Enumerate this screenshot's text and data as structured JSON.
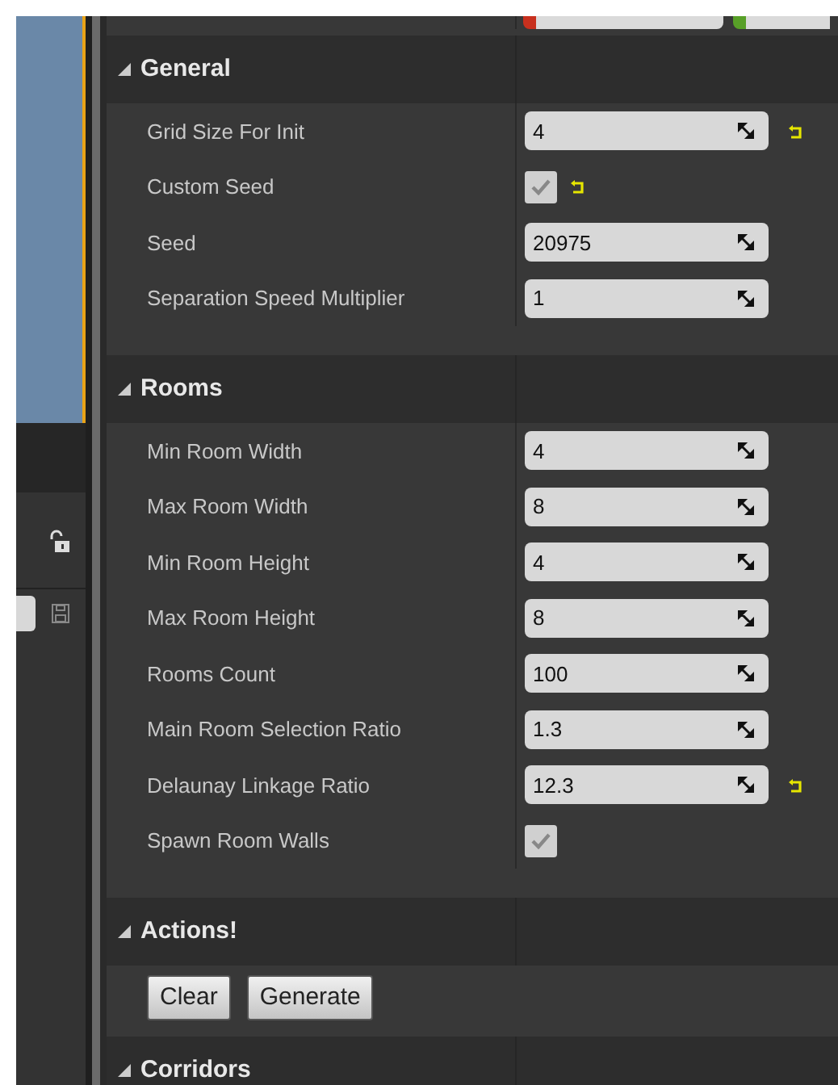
{
  "sections": [
    {
      "title": "General",
      "expanded": true,
      "rows": [
        {
          "kind": "number",
          "label": "Grid Size For Init",
          "value": "4",
          "reset": true
        },
        {
          "kind": "checkbox",
          "label": "Custom Seed",
          "checked": true,
          "reset": true
        },
        {
          "kind": "number",
          "label": "Seed",
          "value": "20975",
          "reset": false
        },
        {
          "kind": "number",
          "label": "Separation Speed Multiplier",
          "value": "1",
          "reset": false
        }
      ]
    },
    {
      "title": "Rooms",
      "expanded": true,
      "rows": [
        {
          "kind": "number",
          "label": "Min Room Width",
          "value": "4",
          "reset": false
        },
        {
          "kind": "number",
          "label": "Max Room Width",
          "value": "8",
          "reset": false
        },
        {
          "kind": "number",
          "label": "Min Room Height",
          "value": "4",
          "reset": false
        },
        {
          "kind": "number",
          "label": "Max Room Height",
          "value": "8",
          "reset": false
        },
        {
          "kind": "number",
          "label": "Rooms Count",
          "value": "100",
          "reset": false
        },
        {
          "kind": "number",
          "label": "Main Room Selection Ratio",
          "value": "1.3",
          "reset": false
        },
        {
          "kind": "number",
          "label": "Delaunay Linkage Ratio",
          "value": "12.3",
          "reset": true
        },
        {
          "kind": "checkbox",
          "label": "Spawn Room Walls",
          "checked": true,
          "reset": false
        }
      ]
    },
    {
      "title": "Actions!",
      "expanded": true,
      "buttons": [
        "Clear",
        "Generate"
      ]
    },
    {
      "title": "Corridors",
      "expanded": true
    }
  ]
}
